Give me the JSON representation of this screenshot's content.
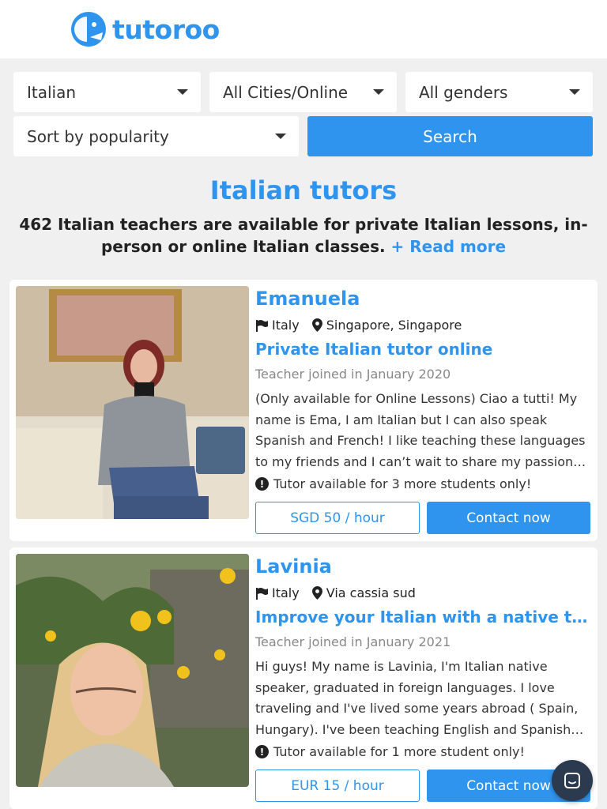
{
  "brand": {
    "name": "tutoroo",
    "accent": "#2f94ee"
  },
  "filters": {
    "language": "Italian",
    "city": "All Cities/Online",
    "gender": "All genders",
    "sort": "Sort by popularity",
    "search_label": "Search"
  },
  "page": {
    "title": "Italian tutors",
    "subtitle": "462 Italian teachers are available for private Italian lessons, in-person or online Italian classes.",
    "read_more": "+ Read more"
  },
  "tutors": [
    {
      "name": "Emanuela",
      "country": "Italy",
      "location": "Singapore, Singapore",
      "headline": "Private Italian tutor online",
      "joined": "Teacher joined in January 2020",
      "description": "(Only available for Online Lessons) Ciao a tutti! My name is Ema, I am Italian but I can also speak Spanish and French! I like teaching these languages to my friends and I can’t wait to share my passion with you",
      "availability": "Tutor available for 3 more students only!",
      "price": "SGD 50 / hour",
      "contact_label": "Contact now"
    },
    {
      "name": "Lavinia",
      "country": "Italy",
      "location": "Via cassia sud",
      "headline": "Improve your Italian with a native teacher",
      "joined": "Teacher joined in January 2021",
      "description": "Hi guys! My name is Lavinia, I'm Italian native speaker, graduated in foreign languages. I love traveling and I've lived some years abroad ( Spain, Hungary). I've been teaching English and Spanish for years",
      "availability": "Tutor available for 1 more student only!",
      "price": "EUR 15 / hour",
      "contact_label": "Contact now"
    }
  ],
  "icons": {
    "flag": "flag-icon",
    "location": "map-marker-icon",
    "alert": "exclamation-circle-icon",
    "chat": "chat-bubble-icon",
    "dropdown": "chevron-down-icon"
  }
}
